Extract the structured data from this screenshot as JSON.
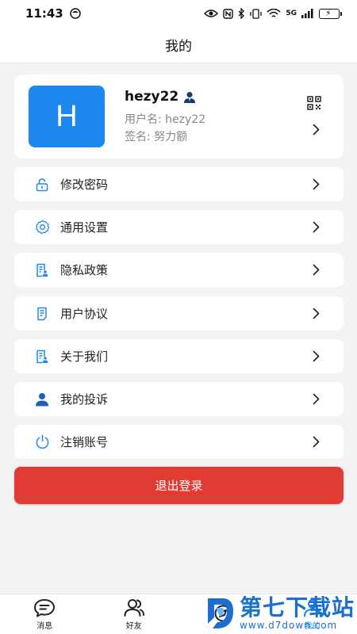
{
  "status_bar": {
    "time": "11:43",
    "network": "5G",
    "icons": [
      "smiley-icon",
      "eye-icon",
      "nfc-icon",
      "bluetooth-icon",
      "vibrate-icon",
      "wifi-icon",
      "signal-icon",
      "battery-icon"
    ]
  },
  "header": {
    "title": "我的"
  },
  "profile": {
    "avatar_letter": "H",
    "username": "hezy22",
    "user_id_line": "用户名: hezy22",
    "signature_line": "签名: 努力额",
    "avatar_color": "#1e88f0"
  },
  "menu": {
    "items": [
      {
        "label": "修改密码",
        "icon": "lock-icon"
      },
      {
        "label": "通用设置",
        "icon": "gear-icon"
      },
      {
        "label": "隐私政策",
        "icon": "document-icon"
      },
      {
        "label": "用户协议",
        "icon": "agreement-icon"
      },
      {
        "label": "关于我们",
        "icon": "document-icon"
      },
      {
        "label": "我的投诉",
        "icon": "person-icon"
      },
      {
        "label": "注销账号",
        "icon": "power-icon"
      }
    ]
  },
  "logout": {
    "label": "退出登录",
    "color": "#e23b33"
  },
  "tabbar": {
    "tabs": [
      {
        "label": "消息",
        "icon": "message-icon"
      },
      {
        "label": "好友",
        "icon": "friends-icon"
      },
      {
        "label": "",
        "icon": "discover-icon"
      },
      {
        "label": "我的",
        "icon": "profile-icon"
      }
    ]
  },
  "watermark": {
    "big": "第七下载站",
    "small": "www.d7down.com"
  },
  "colors": {
    "accent": "#1e88f0",
    "danger": "#e23b33",
    "background": "#f3f3f3"
  }
}
